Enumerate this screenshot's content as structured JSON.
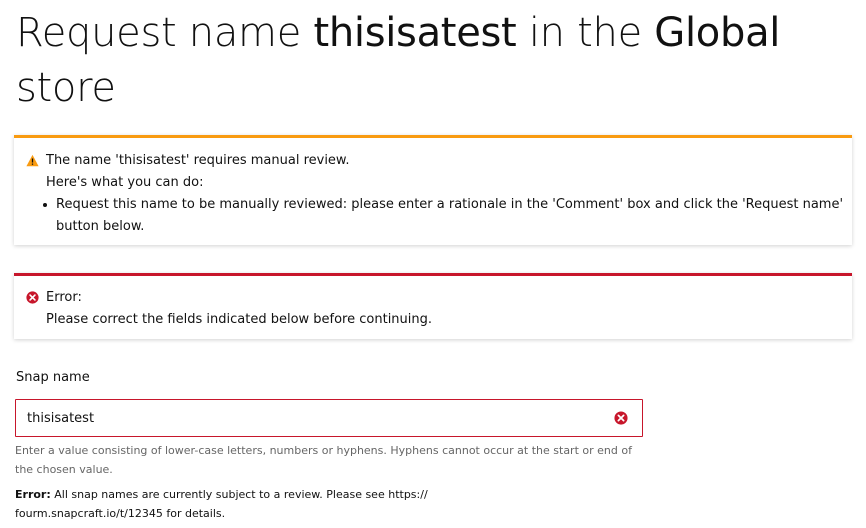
{
  "title": {
    "prefix": "Request name ",
    "snap_name": "thisisatest",
    "middle": " in the ",
    "store": "Global",
    "suffix": "store"
  },
  "caution_notification": {
    "icon": "warning-icon",
    "color": "#f99b11",
    "message": "The name 'thisisatest' requires manual review.",
    "subheading": "Here's what you can do:",
    "options": [
      {
        "line1": "Request this name to be manually reviewed: please enter a rationale in the 'Comment' box and click the 'Request name'",
        "line2": "button below."
      }
    ]
  },
  "error_notification": {
    "icon": "error-icon",
    "color": "#c7162b",
    "title": "Error:",
    "message": "Please correct the fields indicated below before continuing."
  },
  "snap_name_field": {
    "label": "Snap name",
    "value": "thisisatest",
    "help_line1": "Enter a value consisting of lower-case letters, numbers or hyphens. Hyphens cannot occur at the start or end of",
    "help_line2": "the chosen value.",
    "error_label": "Error:",
    "error_line1": " All snap names are currently subject to a review. Please see https://",
    "error_line2": "fourm.snapcraft.io/t/12345 for details."
  }
}
